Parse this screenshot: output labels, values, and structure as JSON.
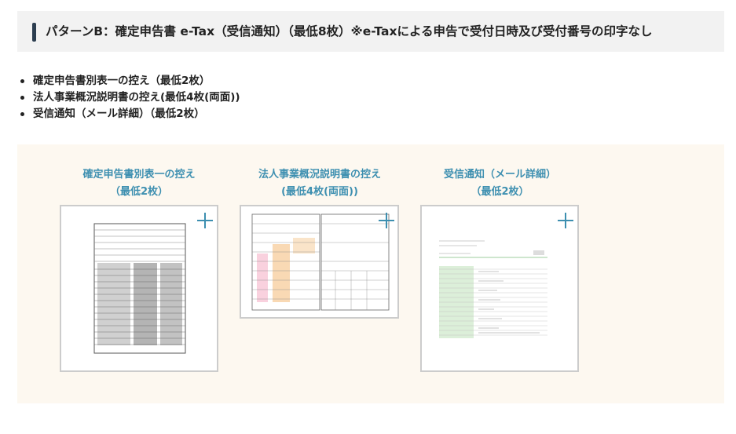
{
  "header": {
    "title": "パターンB：確定申告書 e-Tax（受信通知）（最低8枚）※e-Taxによる申告で受付日時及び受付番号の印字なし"
  },
  "bullets": [
    "確定申告書別表一の控え（最低2枚）",
    "法人事業概況説明書の控え(最低4枚(両面))",
    "受信通知（メール詳細）（最低2枚）"
  ],
  "cards": [
    {
      "title": "確定申告書別表一の控え",
      "subtitle": "（最低2枚）",
      "icon": "plus-icon"
    },
    {
      "title": "法人事業概況説明書の控え",
      "subtitle": "(最低4枚(両面))",
      "icon": "plus-icon"
    },
    {
      "title": "受信通知（メール詳細）",
      "subtitle": "（最低2枚）",
      "icon": "plus-icon"
    }
  ],
  "colors": {
    "accent": "#3d8fb0",
    "panel_bg": "#fdf8f0",
    "header_bg": "#f2f2f2",
    "header_bar": "#2c3e50"
  }
}
